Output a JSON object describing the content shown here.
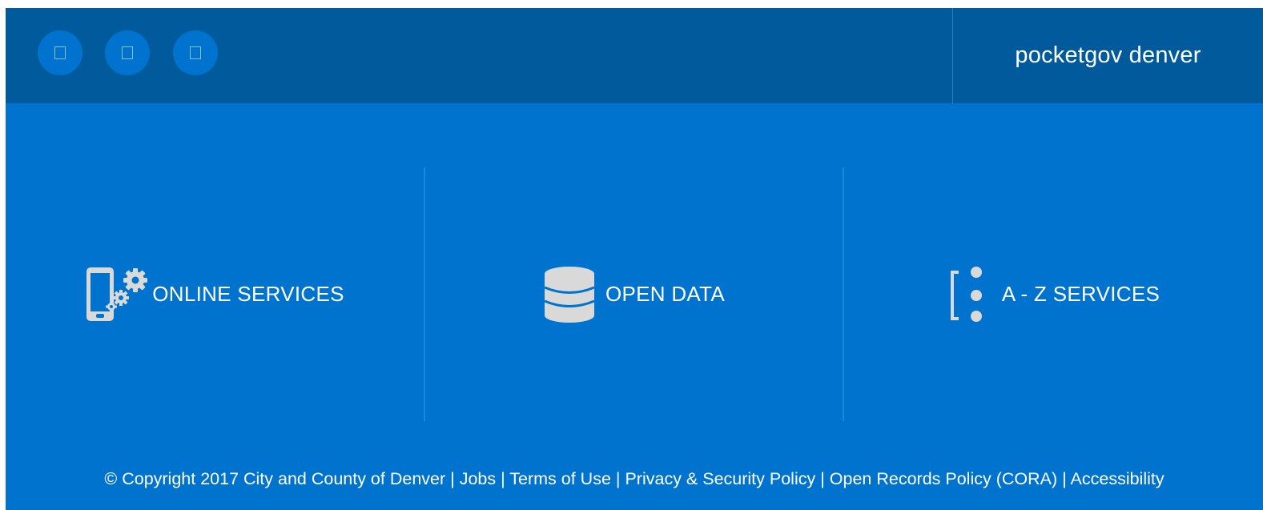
{
  "header": {
    "social_icons": [
      {
        "name": "social-icon-1"
      },
      {
        "name": "social-icon-2"
      },
      {
        "name": "social-icon-3"
      }
    ],
    "brand": "pocketgov denver"
  },
  "services": [
    {
      "label": "ONLINE SERVICES",
      "icon": "mobile-gears-icon"
    },
    {
      "label": "OPEN DATA",
      "icon": "database-icon"
    },
    {
      "label": "A - Z SERVICES",
      "icon": "list-dots-icon"
    }
  ],
  "footer": {
    "copyright": "© Copyright 2017 City and County of Denver",
    "separator": " | ",
    "links": [
      "Jobs",
      "Terms of Use",
      "Privacy & Security Policy",
      "Open Records Policy (CORA)",
      "Accessibility"
    ]
  },
  "colors": {
    "header_bg": "#005a9c",
    "main_bg": "#0073cf",
    "icon_gray": "#d9d9d9",
    "text": "#ffffff"
  }
}
